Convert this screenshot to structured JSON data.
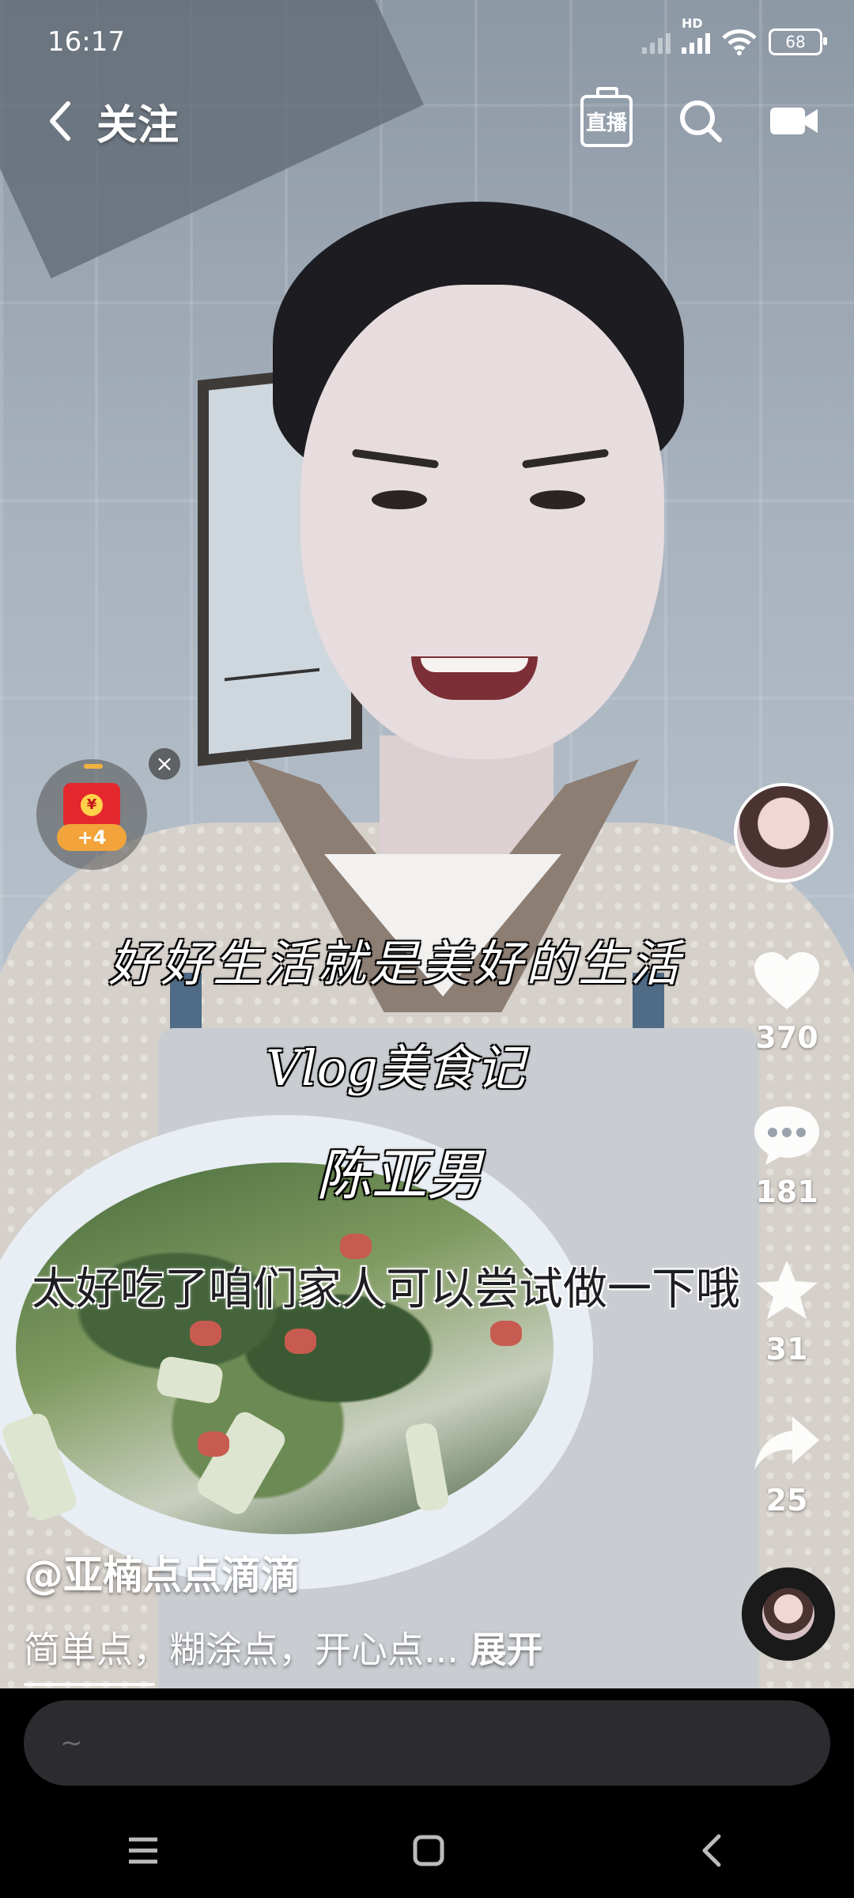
{
  "status_bar": {
    "time": "16:17",
    "network_label": "HD",
    "battery": "68"
  },
  "header": {
    "title": "关注",
    "live_label": "直播"
  },
  "red_packet": {
    "badge": "+4",
    "seal": "¥"
  },
  "captions": {
    "line1": "好好生活就是美好的生活",
    "line2": "Vlog美食记",
    "line3": "陈亚男",
    "subtitle": "太好吃了咱们家人可以尝试做一下哦"
  },
  "actions": {
    "likes": "370",
    "comments": "181",
    "favorites": "31",
    "shares": "25"
  },
  "post": {
    "author": "@亚楠点点滴滴",
    "description": "简单点，糊涂点，开心点...",
    "expand_label": "展开"
  },
  "comment_input": {
    "placeholder": "~"
  },
  "colors": {
    "accent_red": "#e4262d",
    "badge_orange": "#f2a43a"
  }
}
